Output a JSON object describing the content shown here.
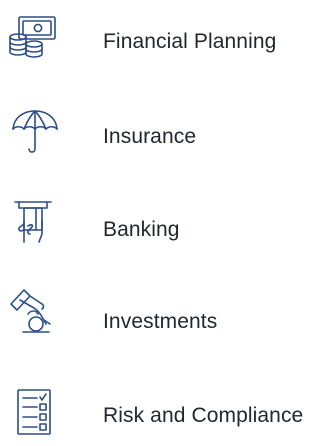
{
  "colors": {
    "icon_stroke": "#2b4f86",
    "text": "#202830",
    "background": "#ffffff"
  },
  "menu": {
    "items": [
      {
        "label": "Financial Planning",
        "icon": "money-coins-icon"
      },
      {
        "label": "Insurance",
        "icon": "umbrella-icon"
      },
      {
        "label": "Banking",
        "icon": "atm-card-hand-icon"
      },
      {
        "label": "Investments",
        "icon": "hand-coin-icon"
      },
      {
        "label": "Risk and Compliance",
        "icon": "checklist-document-icon"
      }
    ]
  }
}
